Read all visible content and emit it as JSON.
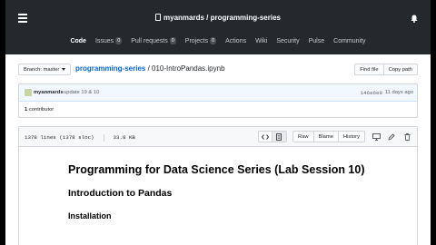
{
  "header": {
    "owner": "myanmards",
    "separator": " / ",
    "repo": "programming-series",
    "nav": [
      {
        "label": "Code",
        "count": null,
        "active": true
      },
      {
        "label": "Issues",
        "count": "0",
        "active": false
      },
      {
        "label": "Pull requests",
        "count": "0",
        "active": false
      },
      {
        "label": "Projects",
        "count": "0",
        "active": false
      },
      {
        "label": "Actions",
        "count": null,
        "active": false
      },
      {
        "label": "Wiki",
        "count": null,
        "active": false
      },
      {
        "label": "Security",
        "count": null,
        "active": false
      },
      {
        "label": "Pulse",
        "count": null,
        "active": false
      },
      {
        "label": "Community",
        "count": null,
        "active": false
      }
    ]
  },
  "breadcrumb": {
    "branch_label": "Branch: master",
    "repo_link": "programming-series",
    "separator": " / ",
    "file": "010-IntroPandas.ipynb",
    "find_file": "Find file",
    "copy_path": "Copy path"
  },
  "commit": {
    "author": "myanmards",
    "message": "update 19 & 10",
    "sha": "146e6e9",
    "time": "11 days ago",
    "contributors_count": "1",
    "contributors_label": " contributor"
  },
  "file": {
    "lines": "1378 lines (1378 sloc)",
    "size": "33.8 KB",
    "raw": "Raw",
    "blame": "Blame",
    "history": "History"
  },
  "notebook": {
    "title": "Programming for Data Science Series (Lab Session 10)",
    "heading": "Introduction to Pandas",
    "subheading": "Installation"
  }
}
